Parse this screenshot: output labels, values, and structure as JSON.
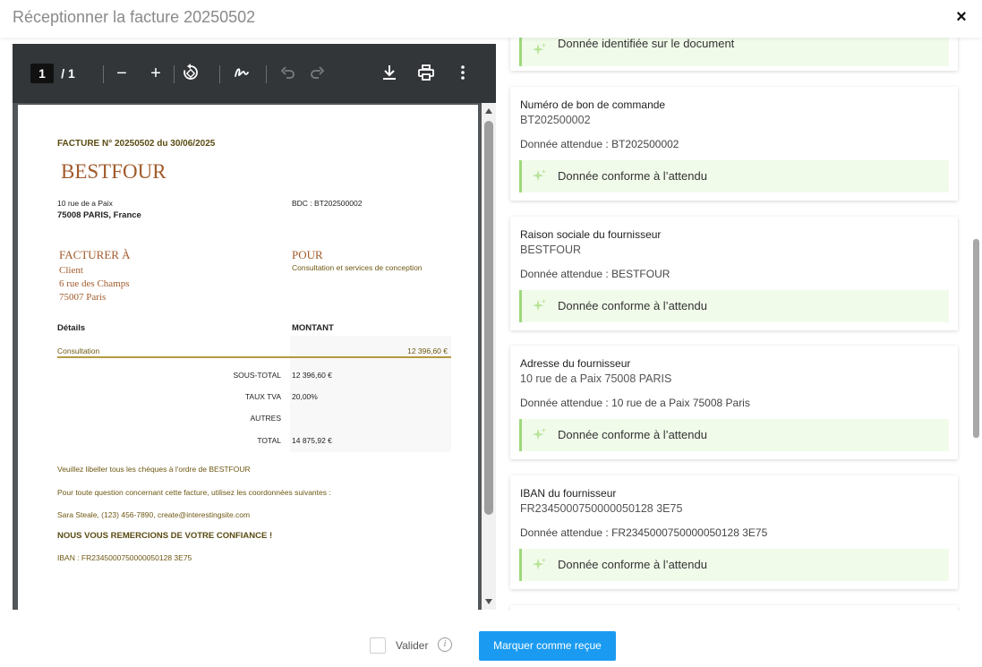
{
  "header": {
    "title": "Réceptionner la facture 20250502",
    "close_label": "×"
  },
  "pdf_toolbar": {
    "current_page": "1",
    "page_total": "/ 1",
    "zoom_out": "−",
    "zoom_in": "+"
  },
  "invoice": {
    "title": "FACTURE N° 20250502 du 30/06/2025",
    "company": "BESTFOUR",
    "address_line1": "10 rue de a Paix",
    "address_line2": "75008 PARIS, France",
    "bdc": "BDC : BT202500002",
    "bill_to_heading": "FACTURER À",
    "bill_to_lines": [
      "Client",
      "6 rue des Champs",
      "75007 Paris"
    ],
    "for_heading": "POUR",
    "for_desc": "Consultation et services de conception",
    "details_heading": "Détails",
    "amount_heading": "MONTANT",
    "line_item": {
      "desc": "Consultation",
      "amount": "12 396,60 €"
    },
    "totals": [
      {
        "label": "SOUS-TOTAL",
        "value": "12 396,60 €"
      },
      {
        "label": "TAUX TVA",
        "value": "20,00%"
      },
      {
        "label": "AUTRES",
        "value": ""
      },
      {
        "label": "TOTAL",
        "value": "14 875,92 €"
      }
    ],
    "notes": [
      "Veuillez libeller tous les chèques à l'ordre de BESTFOUR",
      "Pour toute question concernant cette facture, utilisez les coordonnées suivantes :",
      "Sara Steale, (123) 456-7890, create@interestingsite.com"
    ],
    "thanks": "NOUS VOUS REMERCIONS DE VOTRE CONFIANCE !",
    "iban": "IBAN : FR2345000750000050128 3E75"
  },
  "checks": {
    "top_status": "Donnée identifiée sur le document",
    "cards": [
      {
        "label": "Numéro de bon de commande",
        "value": "BT202500002",
        "expected": "Donnée attendue : BT202500002",
        "status": "Donnée conforme à l’attendu"
      },
      {
        "label": "Raison sociale du fournisseur",
        "value": "BESTFOUR",
        "expected": "Donnée attendue : BESTFOUR",
        "status": "Donnée conforme à l’attendu"
      },
      {
        "label": "Adresse du fournisseur",
        "value": "10 rue de a Paix 75008 PARIS",
        "expected": "Donnée attendue : 10 rue de a Paix 75008 Paris",
        "status": "Donnée conforme à l’attendu"
      },
      {
        "label": "IBAN du fournisseur",
        "value": "FR2345000750000050128 3E75",
        "expected": "Donnée attendue : FR2345000750000050128 3E75",
        "status": "Donnée conforme à l’attendu"
      }
    ]
  },
  "footer": {
    "validate_label": "Valider",
    "info_glyph": "i",
    "primary_button": "Marquer comme reçue"
  },
  "colors": {
    "primary": "#1a9bf1",
    "success_bg": "#f1fbea",
    "success_border": "#9ed87a",
    "sparkle": "#b8e49a"
  }
}
